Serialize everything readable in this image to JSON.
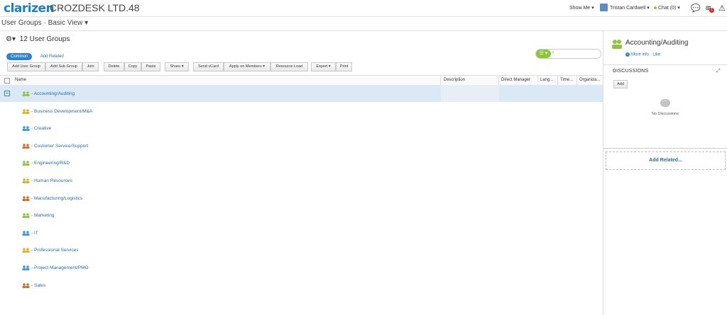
{
  "topbar": {
    "logo": "clarizen",
    "company": "CROZDESK LTD.48",
    "show_me": "Show Me ▾",
    "user": "Tristan Cardwell ▾",
    "chat": "Chat (0) ▾",
    "notification_count": "1",
    "chat_dot_color": "#8bc34a"
  },
  "viewbar": {
    "title": "User Groups · Basic View ▾"
  },
  "header": {
    "title": "12 User Groups",
    "gear": "⚙▾"
  },
  "tabs": {
    "common": "Common",
    "add_related": "Add Related"
  },
  "search": {
    "placeholder": "",
    "filter_icon": "☰ ▾"
  },
  "toolbar": {
    "add_user_group": "Add User Group",
    "add_sub_group": "Add Sub Group",
    "join": "Join",
    "delete": "Delete",
    "copy": "Copy",
    "paste": "Paste",
    "share": "Share ▾",
    "send_vcard": "Send vCard",
    "apply_on_members": "Apply on Members ▾",
    "resource_load": "Resource Load",
    "export": "Export ▾",
    "print": "Print"
  },
  "columns": {
    "name": "Name",
    "description": "Description",
    "direct_manager": "Direct Manager",
    "lang": "Lang...",
    "time": "Time...",
    "organiza": "Organiza..."
  },
  "groups": [
    {
      "name": "Accounting/Auditing",
      "color": "#8cc63f"
    },
    {
      "name": "Business Development/M&A",
      "color": "#e0b030"
    },
    {
      "name": "Creative",
      "color": "#3a9ad9"
    },
    {
      "name": "Customer Service/Support",
      "color": "#c8742a"
    },
    {
      "name": "Engineering/R&D",
      "color": "#8cc63f"
    },
    {
      "name": "Human Resources",
      "color": "#e0b030"
    },
    {
      "name": "Manufacturing/Logistics",
      "color": "#c8742a"
    },
    {
      "name": "Marketing",
      "color": "#8cc63f"
    },
    {
      "name": "IT",
      "color": "#3a9ad9"
    },
    {
      "name": "Professional Services",
      "color": "#e0b030"
    },
    {
      "name": "Project Management/PMO",
      "color": "#3a9ad9"
    },
    {
      "name": "Sales",
      "color": "#c8742a"
    }
  ],
  "right_panel": {
    "title": "Accounting/Auditing",
    "more_info": "More info · Like",
    "discussions": "DISCUSSIONS",
    "add": "Add",
    "no_discussions": "No Discussions",
    "add_related": "Add Related..."
  }
}
